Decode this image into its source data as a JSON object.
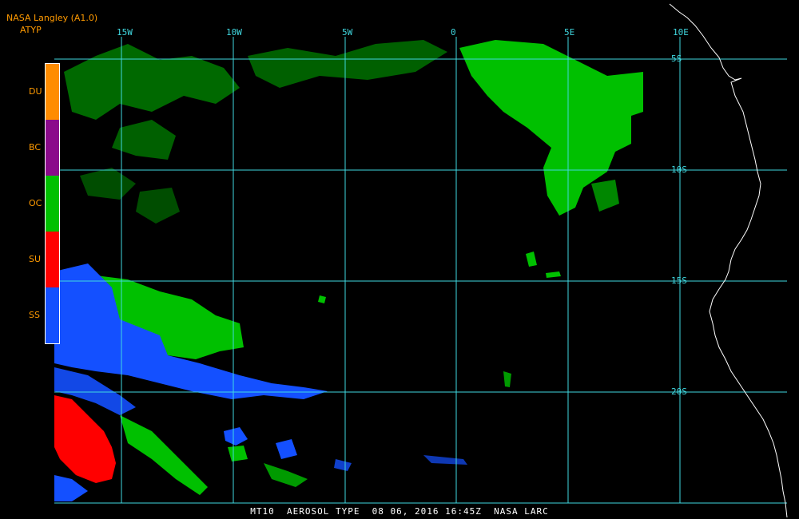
{
  "header": {
    "producer": "NASA Langley (A1.0)",
    "field": "ATYP"
  },
  "legend": {
    "items": [
      {
        "label": "DU",
        "color": "#ff8c00"
      },
      {
        "label": "BC",
        "color": "#8b0a8b"
      },
      {
        "label": "OC",
        "color": "#00c000"
      },
      {
        "label": "SU",
        "color": "#ff0000"
      },
      {
        "label": "SS",
        "color": "#1450ff"
      }
    ]
  },
  "grid": {
    "longitudes": [
      "15W",
      "10W",
      "5W",
      "0",
      "5E",
      "10E"
    ],
    "latitudes": [
      "5S",
      "10S",
      "15S",
      "20S"
    ],
    "line_color": "#40d8e0"
  },
  "coastline_color": "#ffffff",
  "footer": {
    "text": "MT10  AEROSOL TYPE  08 06, 2016 16:45Z  NASA LARC"
  }
}
